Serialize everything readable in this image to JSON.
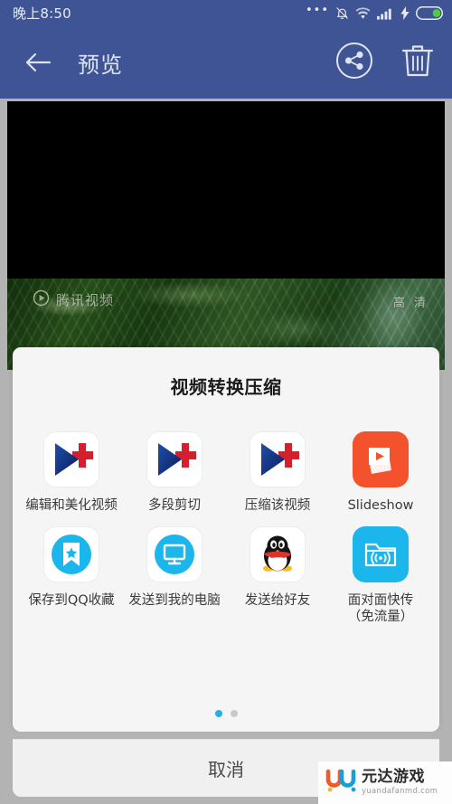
{
  "status_bar": {
    "time": "晚上8:50",
    "icons": [
      "more-dots-icon",
      "alarm-off-icon",
      "wifi-icon",
      "signal-bars-icon",
      "charging-bolt-icon",
      "battery-icon"
    ]
  },
  "app_bar": {
    "back_icon": "back-arrow-icon",
    "title": "预览",
    "share_icon": "share-circle-icon",
    "delete_icon": "trash-icon"
  },
  "video_preview": {
    "watermark_text": "腾讯视频",
    "watermark_icon": "play-circle-icon",
    "quality_label": "高 清"
  },
  "share_sheet": {
    "title": "视频转换压缩",
    "items": [
      {
        "label": "编辑和美化视频",
        "icon": "video-editor-play-icon",
        "style": "play-logo"
      },
      {
        "label": "多段剪切",
        "icon": "video-editor-play-icon",
        "style": "play-logo"
      },
      {
        "label": "压缩该视频",
        "icon": "video-editor-play-icon",
        "style": "play-logo"
      },
      {
        "label": "Slideshow",
        "icon": "slideshow-icon",
        "style": "slideshow"
      },
      {
        "label": "保存到QQ收藏",
        "icon": "bookmark-star-icon",
        "style": "qq-favorite"
      },
      {
        "label": "发送到我的电脑",
        "icon": "monitor-icon",
        "style": "my-computer"
      },
      {
        "label": "发送给好友",
        "icon": "qq-penguin-icon",
        "style": "qq-friend"
      },
      {
        "label": "面对面快传\n（免流量）",
        "icon": "folder-broadcast-icon",
        "style": "face-to-face"
      }
    ],
    "pager": {
      "total": 2,
      "active_index": 0
    },
    "cancel_label": "取消"
  },
  "watermark": {
    "logo_icon": "yd-logo-icon",
    "brand": "元达游戏",
    "url": "yuandafanmd.com"
  },
  "colors": {
    "header_blue": "#3e5494",
    "accent_blue": "#23b0ef",
    "slideshow_orange": "#f4522c",
    "sheet_bg": "#f5f5f5",
    "page_bg": "#b3b3b3"
  }
}
